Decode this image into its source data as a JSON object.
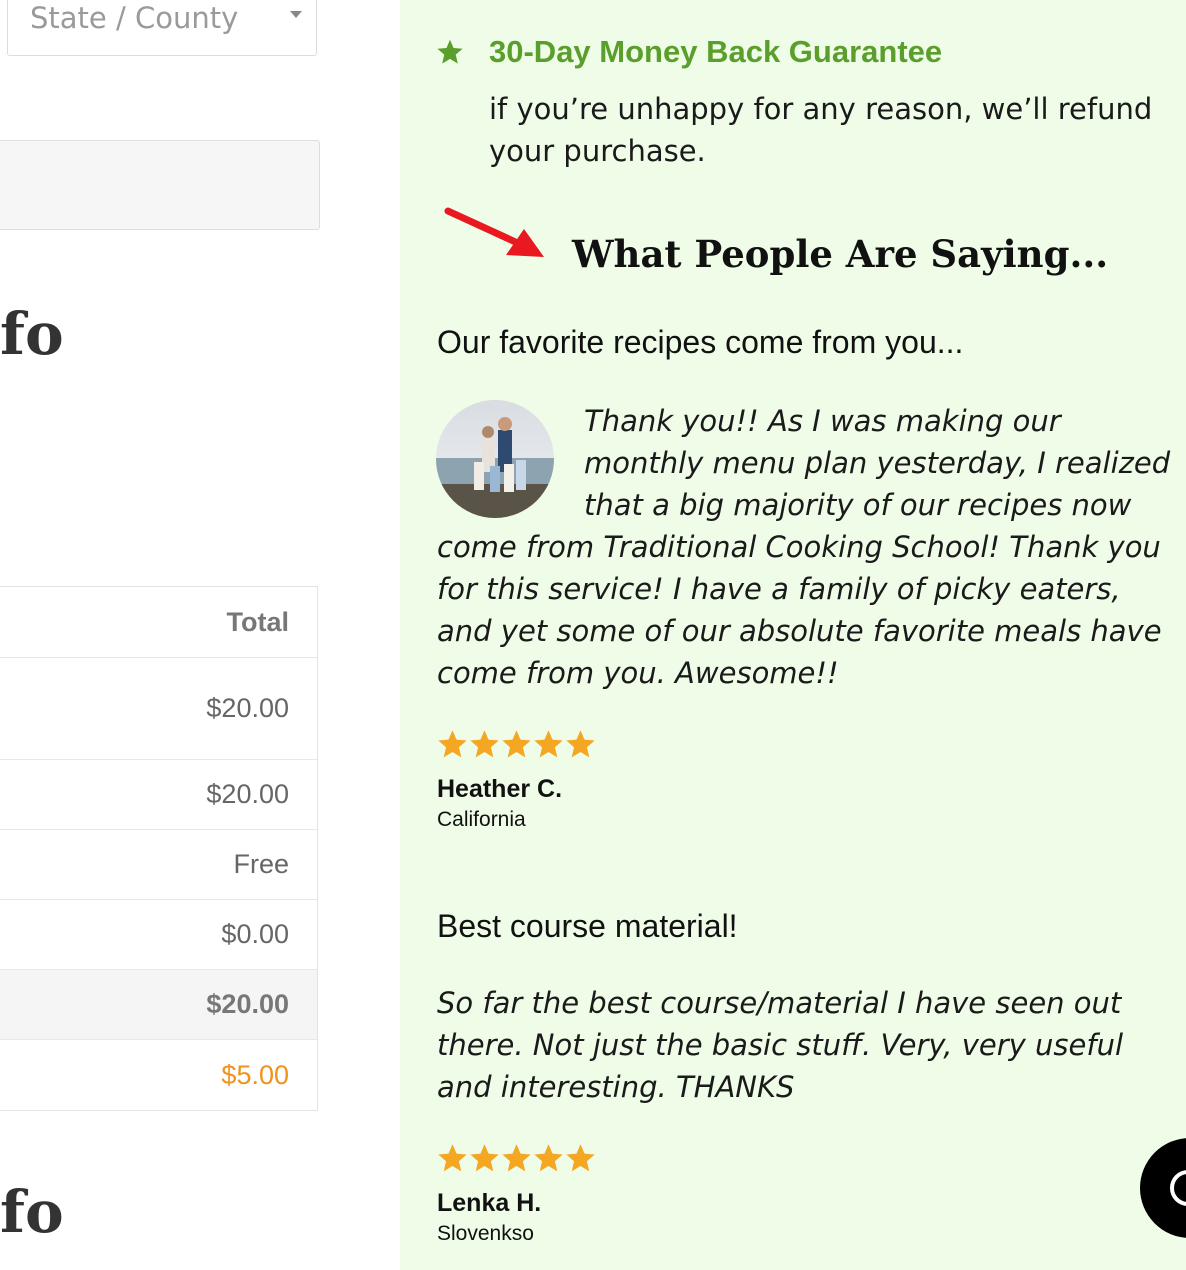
{
  "checkout": {
    "state_placeholder": "State / County",
    "heading_fragment_1": "fo",
    "heading_fragment_2": "fo",
    "order_table": {
      "header": "Total",
      "rows": [
        "$20.00",
        "$20.00",
        "Free",
        "$0.00",
        "$20.00",
        "$5.00"
      ]
    }
  },
  "guarantee": {
    "title": "30-Day Money Back Guarantee",
    "text": "if you’re unhappy for any reason, we’ll refund your purchase."
  },
  "testimonials": {
    "title": "What People Are Saying...",
    "items": [
      {
        "headline": "Our favorite recipes come from you...",
        "quote": "Thank you!! As I was making our monthly menu plan yesterday, I realized that a big majority of our recipes now come from Traditional Cooking School! Thank you for this service! I have a family of picky eaters, and yet some of our absolute favorite meals have come from you. Awesome!!",
        "rating": 5,
        "name": "Heather C.",
        "location": "California"
      },
      {
        "headline": "Best course material!",
        "quote": "So far the best course/material I have seen out there. Not just the basic stuff. Very, very useful and interesting. THANKS",
        "rating": 5,
        "name": "Lenka H.",
        "location": "Slovenkso"
      }
    ]
  },
  "colors": {
    "panel_bg": "#effce8",
    "guarantee_green": "#5a9e2b",
    "star_gold": "#f5a623",
    "discount_orange": "#f0921e",
    "arrow_red": "#e8191f"
  },
  "icons": {
    "guarantee": "star-icon",
    "pointer": "red-arrow-icon",
    "rating": "star-icon",
    "chat": "chat-icon"
  }
}
